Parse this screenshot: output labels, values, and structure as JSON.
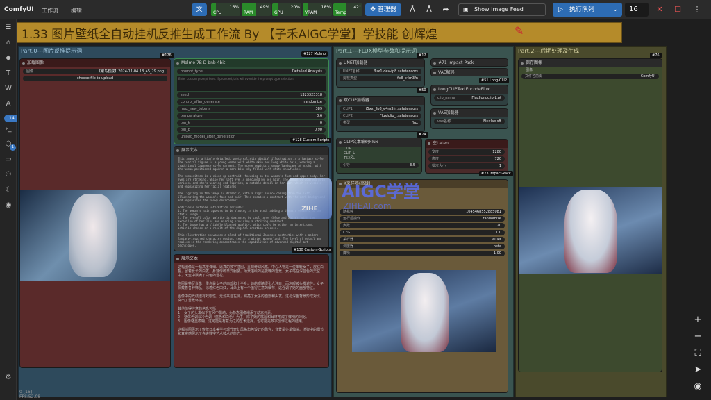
{
  "topbar": {
    "brand": "ComfyUI",
    "menu": [
      "工作流",
      "编辑"
    ],
    "stats": [
      {
        "label": "CPU",
        "value": "16%",
        "pct": 16,
        "color": "#2a8a2a"
      },
      {
        "label": "RAM",
        "value": "49%",
        "pct": 49,
        "color": "#2a8a2a"
      },
      {
        "label": "GPU",
        "value": "20%",
        "pct": 20,
        "color": "#2a8a2a"
      },
      {
        "label": "VRAM",
        "value": "18%",
        "pct": 18,
        "color": "#2a8a2a"
      },
      {
        "label": "Temp",
        "value": "42°",
        "pct": 42,
        "color": "#2a8a2a"
      }
    ],
    "manager": "管理器",
    "image_feed": "Show Image Feed",
    "queue": "执行队列",
    "batch": "16"
  },
  "group_title": "1.33 图片壁纸全自动挂机反推生成工作流 By 【子禾AIGC学堂】学技能 创辉煌",
  "groups": {
    "part0": "Part.0---图片反推提示词",
    "part1": "Part.1---FLUX模型参数和提示词",
    "part2": "Part.2---后期处理及生成"
  },
  "nodes": {
    "load_image": {
      "title": "加载图像",
      "out1": "图像",
      "out2": "遮罩",
      "file_label": "图像",
      "file": "【聚鸟鹤成】2024-11-04 18_45_29.png",
      "upload": "choose file to upload",
      "badge": "#126"
    },
    "molmo": {
      "title": "Molmo 7B D bnb 4bit",
      "badge": "#127 Molmo",
      "in": "image",
      "out": "STRING",
      "rows": [
        [
          "prompt_type",
          "Detailed Analysis"
        ],
        [
          "seed",
          "1323323318"
        ],
        [
          "control_after_generate",
          "randomize"
        ],
        [
          "max_new_tokens",
          "389"
        ],
        [
          "temperature",
          "0.6"
        ],
        [
          "top_k",
          "0"
        ],
        [
          "top_p",
          "0.90"
        ],
        [
          "unload_model_after_generation",
          ""
        ]
      ],
      "placeholder": "Enter custom prompt here. If provided, this will override the prompt type selection."
    },
    "show_text1": {
      "title": "展示文本",
      "in": "文本",
      "out": "字符串",
      "badge": "#128 Custom-Scripts",
      "text": "This image is a highly detailed, photorealistic digital illustration in a fantasy style. The central figure is a young woman with white skin and long white hair, wearing a traditional Japanese-style garment. The scene depicts a snowy landscape at night, with the woman positioned against a dark blue sky filled with white snowflakes.\n\nThe composition is a close-up portrait, focusing on the woman's face and upper body. Her eyes are striking, while her left eye is obscured by her hair. The woman is adorned with various, and she's wearing red lipstick, a notable detail in her ear, which is visible and emphasizing her facial features.\n\nThe lighting in the image is dramatic, with a light source coming from the left, illuminating the woman's face and hair. This creates a contrast with the dark background and emphasizes the snowy environment.\n\nadditional notable information includes:\n1. The woman's hair appears to be blowing in the wind, adding a dynamic element to the static image.\n2. The overall color palette is dominated by cool tones (blue and white), with the exception of her lips and earring providing a striking contrast.\n3. The image has a slightly blurred quality, which could be either an intentional artistic choice or a result of the digital creation process.\n\nThis illustration showcases a blend of traditional Japanese aesthetics with a modern, fantasy-inspired character design, set in a winter wonderland. The level of detail and realism in the rendering demonstrates the capabilities of advanced digital art techniques."
    },
    "show_text2": {
      "title": "展示文本",
      "in": "文本",
      "out": "字符串",
      "badge": "#130 Custom-Scripts",
      "text": "这幅图像是一幅高度详细、逼真的数字插图，呈现奇幻风格。中心人物是一位年轻女子，皮肤白皙，留着长长的白发，身穿传统日式服装。场景描绘的是夜晚的雪景，女子站在深蓝色的天空中，天空中飘满了白色的雪花。\n\n构图是特写肖像，重点是女子的面部和上半身。她的眼睛很引人注目，而左眼被头发遮住。女子佩戴着各种饰品，涂着红色口红，耳朵上有一个值得注意的细节，这强调了她的面部特征。\n\n图像中的光线很有戏剧性，光源来自左侧，照亮了女子的面部和头发。这与深色背景形成对比，突出了雪景环境。\n\n其他值得注意的信息包括：\n1. 女子的头发似乎在风中飘动，为静态图像增添了动态元素。\n2. 整体色调以冷色调（蓝色和白色）为主，除了她的嘴唇和耳环形成了鲜明的对比。\n3. 图像略显模糊，这可能是有意为之的艺术选择，也可能是数字创作过程的结果。\n\n这幅插图展示了传统日本美学与现代奇幻风格角色设计的融合，背景是冬季仙境。渲染中的细节和真实感展示了先进数字艺术技术的能力。"
    },
    "unet": {
      "title": "UNET加载器",
      "badge": "#50",
      "out": "模型",
      "rows": [
        [
          "UNET名称",
          "flux1-dev-fp8.safetensors"
        ],
        [
          "剪枝类型",
          "fp8_e4m3fn"
        ]
      ]
    },
    "dualclip": {
      "title": "双CLIP加载器",
      "badge": "#74",
      "out": "CLIP",
      "rows": [
        [
          "CLIP1",
          "t5xxl_fp8_e4m3fn.safetensors"
        ],
        [
          "CLIP2",
          "FluxIclip_l.safetensors"
        ],
        [
          "类型",
          "flux"
        ]
      ]
    },
    "cliptext": {
      "title": "CLIP文本编码Flux",
      "out": "条件",
      "in1": "CLIP",
      "in2": "CLIP_L",
      "in3": "T5XXL",
      "guidance_label": "引导",
      "guidance": "3.5"
    },
    "impact71": {
      "title": "#71 Impact-Pack"
    },
    "vae_decode": {
      "title": "VAE解码",
      "badge": "#78 #75"
    },
    "longclip_label": {
      "title": "#51 Long-CLIP"
    },
    "longclipenc": {
      "title": "LongCLIPTextEncodeFlux",
      "badge": "#10",
      "in": "clip",
      "out": "CLIP",
      "row": [
        "clip_name",
        "FluxIlongclip-L.pt"
      ]
    },
    "vae_loader": {
      "title": "VAE加载器",
      "badge": "#122",
      "out": "VAE",
      "row": [
        "vae名称",
        "FluxIae.sft"
      ]
    },
    "empty_latent": {
      "title": "空Latent",
      "out": "Latent",
      "badge": "#73 Impact-Pack",
      "rows": [
        [
          "宽度",
          "1280"
        ],
        [
          "高度",
          "720"
        ],
        [
          "批次大小",
          "1"
        ]
      ]
    },
    "ksampler": {
      "title": "K采样器(高级)",
      "rows": [
        [
          "随机种",
          "1045468552885081"
        ],
        [
          "运行后操作",
          "randomize"
        ],
        [
          "步数",
          "20"
        ],
        [
          "CFG",
          "1.0"
        ],
        [
          "采样器",
          "euler"
        ],
        [
          "调度器",
          "beta"
        ],
        [
          "降噪",
          "1.00"
        ]
      ],
      "outs": [
        "模型",
        "正面条件",
        "负面条件",
        "Latent",
        "VAE"
      ]
    },
    "save_image": {
      "title": "保存图像",
      "badge": "#76",
      "in": "图像",
      "prefix_label": "文件名前缀",
      "prefix": "ComfyUI"
    },
    "reroute12": {
      "title": "#12"
    }
  },
  "watermark": {
    "main": "AIGC学堂",
    "sub": "ZIHEAI.com",
    "logo": "ZIHE"
  },
  "sidebar_badges": {
    "queue": "14",
    "models": "1"
  },
  "status": {
    "line1": "0 [16]",
    "fps": "FPS:52.08"
  },
  "icons": [
    "translate-icon",
    "text-a-icon",
    "text-a2-icon",
    "share-arrow-icon",
    "close-icon",
    "stop-icon",
    "plus-icon",
    "minus-icon",
    "fit-icon",
    "pointer-icon",
    "eye-icon"
  ]
}
